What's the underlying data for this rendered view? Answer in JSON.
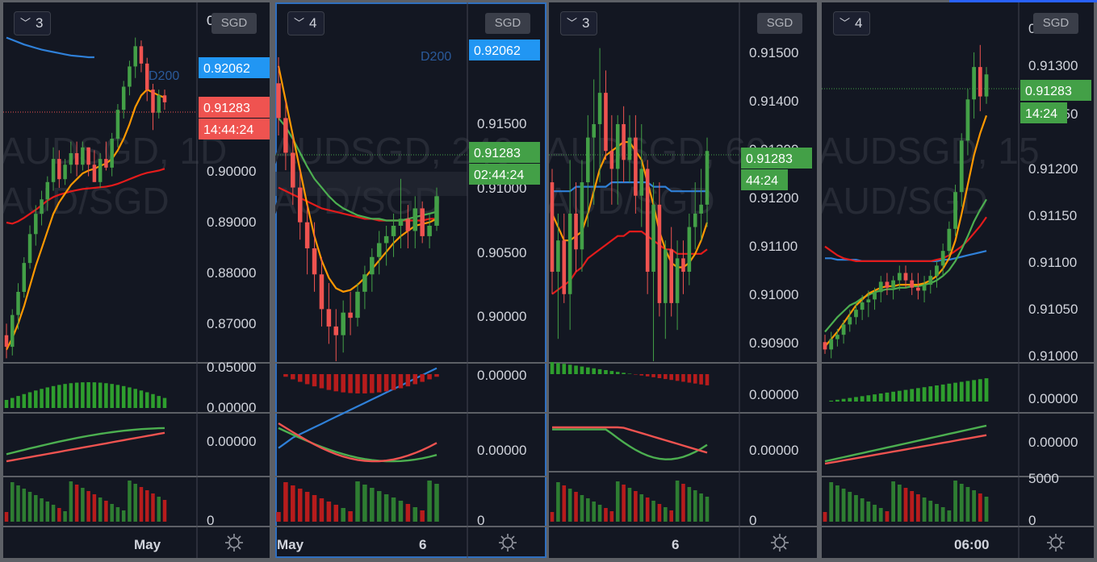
{
  "colors": {
    "background": "#131722",
    "grid": "#3d414c",
    "axis_text": "#d1d4dc",
    "watermark": "#262a35",
    "up": "#43a047",
    "down": "#ef5350",
    "ma_orange": "#ff9800",
    "ma_red": "#e31b1b",
    "ma_blue": "#2f80d8",
    "ma_green": "#4caf50",
    "price_label_green": "#43a047",
    "price_label_red": "#ef5350",
    "price_label_blue": "#2196f3",
    "active_border": "#2f6fbf"
  },
  "panes": [
    {
      "interval_value": "3",
      "currency": "SGD",
      "watermark": [
        "AUDSGD, 1D",
        "AUD/SGD"
      ],
      "price_axis": [
        "0.05000",
        "0.90000",
        "0.89000",
        "0.88000",
        "0.87000"
      ],
      "price_axis_top_partial": "0",
      "price_labels": [
        {
          "text": "0.92062",
          "color": "blue"
        },
        {
          "text": "0.91283",
          "color": "red"
        },
        {
          "text": "14:44:24",
          "color": "red"
        }
      ],
      "ma_label": "D200",
      "ind1_axis": [
        "0.05000",
        "0.00000"
      ],
      "ind2_axis": [
        "0.00000"
      ],
      "ind3_axis": [
        "0"
      ],
      "time_axis": [
        "May"
      ],
      "settings_icon": "gear-icon",
      "candles": [
        [
          0.8725,
          0.8745,
          0.8685,
          0.8705
        ],
        [
          0.8705,
          0.877,
          0.869,
          0.876
        ],
        [
          0.876,
          0.8815,
          0.8735,
          0.88
        ],
        [
          0.88,
          0.886,
          0.879,
          0.885
        ],
        [
          0.885,
          0.8915,
          0.884,
          0.89
        ],
        [
          0.89,
          0.895,
          0.888,
          0.8935
        ],
        [
          0.8935,
          0.8975,
          0.8915,
          0.896
        ],
        [
          0.896,
          0.9,
          0.894,
          0.899
        ],
        [
          0.899,
          0.905,
          0.8975,
          0.903
        ],
        [
          0.903,
          0.9045,
          0.898,
          0.8995
        ],
        [
          0.8995,
          0.903,
          0.8985,
          0.902
        ],
        [
          0.902,
          0.906,
          0.9005,
          0.904
        ],
        [
          0.904,
          0.906,
          0.9,
          0.902
        ],
        [
          0.902,
          0.906,
          0.901,
          0.905
        ],
        [
          0.905,
          0.905,
          0.9,
          0.902
        ],
        [
          0.902,
          0.9045,
          0.899,
          0.899
        ],
        [
          0.899,
          0.904,
          0.898,
          0.903
        ],
        [
          0.903,
          0.906,
          0.901,
          0.9015
        ],
        [
          0.9015,
          0.9075,
          0.9,
          0.9065
        ],
        [
          0.9065,
          0.9125,
          0.905,
          0.9115
        ],
        [
          0.9115,
          0.9165,
          0.91,
          0.9155
        ],
        [
          0.9155,
          0.92,
          0.914,
          0.919
        ],
        [
          0.919,
          0.924,
          0.917,
          0.9225
        ],
        [
          0.9225,
          0.9235,
          0.918,
          0.9195
        ],
        [
          0.9195,
          0.9205,
          0.913,
          0.915
        ],
        [
          0.915,
          0.916,
          0.908,
          0.911
        ],
        [
          0.911,
          0.915,
          0.91,
          0.914
        ],
        [
          0.914,
          0.915,
          0.9115,
          0.9128
        ]
      ],
      "ma_orange": [
        0.87,
        0.872,
        0.8745,
        0.8775,
        0.881,
        0.8845,
        0.8875,
        0.8905,
        0.8935,
        0.8955,
        0.897,
        0.8985,
        0.8995,
        0.9005,
        0.901,
        0.9013,
        0.9018,
        0.9022,
        0.903,
        0.9045,
        0.9065,
        0.909,
        0.912,
        0.914,
        0.915,
        0.9145,
        0.914,
        0.9136
      ],
      "ma_red": [
        0.892,
        0.8918,
        0.8922,
        0.8928,
        0.8935,
        0.8942,
        0.895,
        0.8958,
        0.8964,
        0.8968,
        0.8971,
        0.8974,
        0.8976,
        0.8978,
        0.8979,
        0.898,
        0.8981,
        0.8982,
        0.8984,
        0.8987,
        0.8991,
        0.8995,
        0.8999,
        0.9003,
        0.9006,
        0.9008,
        0.901,
        0.9013
      ],
      "ma_blue": [
        0.924,
        0.9236,
        0.9232,
        0.9228,
        0.9225,
        0.9222,
        0.9219,
        0.9217,
        0.9215,
        0.9213,
        0.9211,
        0.9209,
        0.9208,
        0.9207,
        0.9206,
        0.9206
      ]
    },
    {
      "interval_value": "4",
      "currency": "SGD",
      "watermark": [
        "AUDSGD, 240",
        "AUD/SGD"
      ],
      "price_axis": [
        "0.91500",
        "0.91000",
        "0.90500",
        "0.90000"
      ],
      "price_labels": [
        {
          "text": "0.92062",
          "color": "blue"
        },
        {
          "text": "0.91283",
          "color": "green"
        },
        {
          "text": "02:44:24",
          "color": "green"
        }
      ],
      "ma_label": "D200",
      "ind1_axis": [
        "0.00000"
      ],
      "ind2_axis": [
        "0.00000"
      ],
      "ind3_axis": [
        "0"
      ],
      "time_axis": [
        "May",
        "6"
      ],
      "settings_icon": "gear-icon",
      "candles": [
        [
          0.92,
          0.9215,
          0.917,
          0.918
        ],
        [
          0.918,
          0.919,
          0.915,
          0.916
        ],
        [
          0.916,
          0.917,
          0.913,
          0.914
        ],
        [
          0.914,
          0.915,
          0.911,
          0.912
        ],
        [
          0.912,
          0.913,
          0.909,
          0.9105
        ],
        [
          0.9105,
          0.912,
          0.908,
          0.909
        ],
        [
          0.909,
          0.91,
          0.906,
          0.907
        ],
        [
          0.907,
          0.9085,
          0.905,
          0.906
        ],
        [
          0.906,
          0.907,
          0.904,
          0.9055
        ],
        [
          0.9055,
          0.9075,
          0.9045,
          0.9068
        ],
        [
          0.9068,
          0.908,
          0.9055,
          0.9065
        ],
        [
          0.9065,
          0.9085,
          0.906,
          0.908
        ],
        [
          0.908,
          0.9095,
          0.907,
          0.909
        ],
        [
          0.909,
          0.9105,
          0.908,
          0.91
        ],
        [
          0.91,
          0.9115,
          0.909,
          0.9108
        ],
        [
          0.9108,
          0.9118,
          0.9095,
          0.9112
        ],
        [
          0.9112,
          0.9125,
          0.91,
          0.9118
        ],
        [
          0.9118,
          0.9145,
          0.9105,
          0.9122
        ],
        [
          0.9122,
          0.913,
          0.9105,
          0.9115
        ],
        [
          0.9115,
          0.9135,
          0.9105,
          0.9128
        ],
        [
          0.9128,
          0.9132,
          0.9108,
          0.9112
        ],
        [
          0.9112,
          0.9125,
          0.9105,
          0.9118
        ],
        [
          0.9118,
          0.914,
          0.9115,
          0.9135
        ]
      ],
      "ma_orange": [
        0.921,
        0.919,
        0.917,
        0.915,
        0.913,
        0.9112,
        0.9098,
        0.9088,
        0.9082,
        0.908,
        0.9081,
        0.9084,
        0.9088,
        0.9093,
        0.9098,
        0.9103,
        0.9108,
        0.9112,
        0.9115,
        0.9118,
        0.9119,
        0.912,
        0.9122
      ],
      "ma_red": [
        0.914,
        0.9138,
        0.9136,
        0.9134,
        0.9132,
        0.913,
        0.9128,
        0.9127,
        0.9126,
        0.9125,
        0.9124,
        0.9123,
        0.9122,
        0.9122,
        0.9121,
        0.9121,
        0.9121,
        0.9121,
        0.9121,
        0.9121,
        0.9121,
        0.9122,
        0.9122
      ],
      "ma_green": [
        0.918,
        0.9175,
        0.9168,
        0.916,
        0.9152,
        0.9145,
        0.914,
        0.9135,
        0.9131,
        0.9128,
        0.9126,
        0.9124,
        0.9123,
        0.9122,
        0.9122,
        0.9121,
        0.9121,
        0.9121,
        0.9122,
        0.9123,
        0.9124,
        0.9125,
        0.9126
      ],
      "ma_blue": [
        0.899,
        0.8993,
        0.8996,
        0.8998,
        0.9,
        0.9002,
        0.9004,
        0.9006,
        0.9008,
        0.901,
        0.9012,
        0.9014,
        0.9016,
        0.9018,
        0.902,
        0.9022,
        0.9024,
        0.9026,
        0.9028,
        0.903,
        0.9032,
        0.9034,
        0.9036
      ]
    },
    {
      "interval_value": "3",
      "currency": "SGD",
      "watermark": [
        "AUDSGD, 60",
        "AUD/SGD"
      ],
      "price_axis": [
        "0.91500",
        "0.91400",
        "0.91300",
        "0.91200",
        "0.91100",
        "0.91000",
        "0.90900"
      ],
      "price_labels": [
        {
          "text": "0.91283",
          "color": "green"
        },
        {
          "text": "44:24",
          "color": "green"
        }
      ],
      "ind1_axis": [
        "0.00000"
      ],
      "ind2_axis": [
        "0.00000"
      ],
      "ind3_axis": [
        "0"
      ],
      "time_axis": [
        "6"
      ],
      "settings_icon": "gear-icon",
      "candles": [
        [
          0.9125,
          0.9128,
          0.91,
          0.9105
        ],
        [
          0.9105,
          0.9118,
          0.909,
          0.9112
        ],
        [
          0.9112,
          0.9118,
          0.9098,
          0.91
        ],
        [
          0.91,
          0.913,
          0.9092,
          0.9118
        ],
        [
          0.9118,
          0.9125,
          0.9105,
          0.911
        ],
        [
          0.911,
          0.913,
          0.9105,
          0.9125
        ],
        [
          0.9125,
          0.914,
          0.9115,
          0.9135
        ],
        [
          0.9135,
          0.9148,
          0.912,
          0.9138
        ],
        [
          0.9138,
          0.9155,
          0.9125,
          0.9145
        ],
        [
          0.9145,
          0.915,
          0.913,
          0.9132
        ],
        [
          0.9132,
          0.914,
          0.912,
          0.9128
        ],
        [
          0.9128,
          0.914,
          0.912,
          0.9138
        ],
        [
          0.9138,
          0.9142,
          0.9125,
          0.913
        ],
        [
          0.913,
          0.914,
          0.9125,
          0.9135
        ],
        [
          0.9135,
          0.914,
          0.9118,
          0.9122
        ],
        [
          0.9122,
          0.9138,
          0.9115,
          0.9128
        ],
        [
          0.9128,
          0.913,
          0.91,
          0.9105
        ],
        [
          0.9105,
          0.9125,
          0.9085,
          0.912
        ],
        [
          0.912,
          0.9125,
          0.9095,
          0.9098
        ],
        [
          0.9098,
          0.9112,
          0.909,
          0.911
        ],
        [
          0.911,
          0.9115,
          0.9095,
          0.9098
        ],
        [
          0.9098,
          0.9112,
          0.9092,
          0.9108
        ],
        [
          0.9108,
          0.9112,
          0.91,
          0.9105
        ],
        [
          0.9105,
          0.9118,
          0.9102,
          0.9115
        ],
        [
          0.9115,
          0.9125,
          0.911,
          0.9118
        ],
        [
          0.9118,
          0.9128,
          0.9112,
          0.912
        ],
        [
          0.912,
          0.9135,
          0.9115,
          0.9132
        ]
      ],
      "ma_orange": [
        0.9118,
        0.9115,
        0.9112,
        0.9112,
        0.9113,
        0.9114,
        0.9118,
        0.9123,
        0.9128,
        0.9131,
        0.9132,
        0.9133,
        0.9134,
        0.9134,
        0.9132,
        0.913,
        0.9125,
        0.912,
        0.9114,
        0.911,
        0.9107,
        0.9106,
        0.9106,
        0.9107,
        0.9109,
        0.9112,
        0.9116
      ],
      "ma_red": [
        0.91,
        0.9101,
        0.9102,
        0.9103,
        0.9105,
        0.9106,
        0.9108,
        0.9109,
        0.911,
        0.9111,
        0.9112,
        0.9113,
        0.9113,
        0.9114,
        0.9114,
        0.9114,
        0.9113,
        0.9112,
        0.9111,
        0.911,
        0.911,
        0.9109,
        0.9109,
        0.9109,
        0.9109,
        0.9109,
        0.911
      ],
      "ma_blue": [
        0.9123,
        0.9123,
        0.9123,
        0.9123,
        0.9124,
        0.9124,
        0.9124,
        0.9124,
        0.9124,
        0.9124,
        0.9125,
        0.9125,
        0.9125,
        0.9125,
        0.9125,
        0.9125,
        0.9125,
        0.9124,
        0.9124,
        0.9124,
        0.9123,
        0.9123,
        0.9123,
        0.9123,
        0.9123,
        0.9123,
        0.9123
      ]
    },
    {
      "interval_value": "4",
      "currency": "SGD",
      "watermark": [
        "AUDSGD, 15",
        "AUD/SGD"
      ],
      "price_axis": [
        "0.91300",
        "0.91250",
        "0.91200",
        "0.91150",
        "0.91100",
        "0.91050",
        "0.91000"
      ],
      "price_axis_top_partial": "0.91350",
      "price_labels": [
        {
          "text": "0.91283",
          "color": "green"
        },
        {
          "text": "14:24",
          "color": "green"
        }
      ],
      "ind1_axis": [
        "0.00000"
      ],
      "ind2_axis": [
        "0.00000"
      ],
      "ind3_axis": [
        "5000",
        "0"
      ],
      "time_axis": [
        "06:00"
      ],
      "settings_icon": "gear-icon",
      "candles": [
        [
          0.9103,
          0.9108,
          0.9095,
          0.9098
        ],
        [
          0.9098,
          0.911,
          0.9092,
          0.9105
        ],
        [
          0.9105,
          0.9112,
          0.91,
          0.9108
        ],
        [
          0.9108,
          0.9118,
          0.9102,
          0.9115
        ],
        [
          0.9115,
          0.9125,
          0.911,
          0.912
        ],
        [
          0.912,
          0.913,
          0.9115,
          0.9125
        ],
        [
          0.9125,
          0.9135,
          0.9118,
          0.913
        ],
        [
          0.913,
          0.9138,
          0.912,
          0.9132
        ],
        [
          0.9132,
          0.914,
          0.9125,
          0.9137
        ],
        [
          0.9137,
          0.9148,
          0.913,
          0.9144
        ],
        [
          0.9144,
          0.915,
          0.9135,
          0.914
        ],
        [
          0.914,
          0.9148,
          0.9132,
          0.9145
        ],
        [
          0.9145,
          0.9155,
          0.9138,
          0.915
        ],
        [
          0.915,
          0.9155,
          0.914,
          0.9145
        ],
        [
          0.9145,
          0.915,
          0.9135,
          0.914
        ],
        [
          0.914,
          0.915,
          0.9132,
          0.9138
        ],
        [
          0.9138,
          0.9148,
          0.913,
          0.9142
        ],
        [
          0.9142,
          0.9152,
          0.9136,
          0.9148
        ],
        [
          0.9148,
          0.9158,
          0.914,
          0.9155
        ],
        [
          0.9155,
          0.917,
          0.9148,
          0.9165
        ],
        [
          0.9165,
          0.9185,
          0.916,
          0.918
        ],
        [
          0.918,
          0.921,
          0.9175,
          0.9205
        ],
        [
          0.9205,
          0.9245,
          0.9195,
          0.924
        ],
        [
          0.924,
          0.9275,
          0.923,
          0.9268
        ],
        [
          0.9268,
          0.93,
          0.9255,
          0.929
        ],
        [
          0.929,
          0.9305,
          0.926,
          0.927
        ],
        [
          0.927,
          0.929,
          0.9265,
          0.9285
        ]
      ],
      "ma_orange": [
        0.91,
        0.9105,
        0.911,
        0.9116,
        0.9122,
        0.9128,
        0.9132,
        0.9136,
        0.9138,
        0.914,
        0.9141,
        0.9141,
        0.9142,
        0.9142,
        0.9142,
        0.9142,
        0.9143,
        0.9145,
        0.9148,
        0.9153,
        0.916,
        0.9172,
        0.919,
        0.921,
        0.923,
        0.9245,
        0.9257
      ],
      "ma_red": [
        0.9168,
        0.9165,
        0.9162,
        0.916,
        0.9159,
        0.9158,
        0.9158,
        0.9158,
        0.9158,
        0.9158,
        0.9158,
        0.9158,
        0.9158,
        0.9158,
        0.9158,
        0.9158,
        0.9158,
        0.9158,
        0.9159,
        0.916,
        0.9162,
        0.9165,
        0.9168,
        0.9172,
        0.9177,
        0.9182,
        0.9188
      ],
      "ma_green": [
        0.911,
        0.9115,
        0.912,
        0.9124,
        0.9128,
        0.913,
        0.9133,
        0.9135,
        0.9137,
        0.9138,
        0.9139,
        0.9139,
        0.914,
        0.914,
        0.9141,
        0.9141,
        0.9142,
        0.9143,
        0.9145,
        0.9148,
        0.9152,
        0.9158,
        0.9166,
        0.9175,
        0.9185,
        0.9193,
        0.92
      ],
      "ma_blue": [
        0.916,
        0.916,
        0.9159,
        0.9159,
        0.9159,
        0.9159,
        0.9158,
        0.9158,
        0.9158,
        0.9158,
        0.9158,
        0.9158,
        0.9158,
        0.9158,
        0.9158,
        0.9158,
        0.9158,
        0.9158,
        0.9158,
        0.9159,
        0.9159,
        0.916,
        0.9161,
        0.9162,
        0.9163,
        0.9164,
        0.9165
      ]
    }
  ]
}
